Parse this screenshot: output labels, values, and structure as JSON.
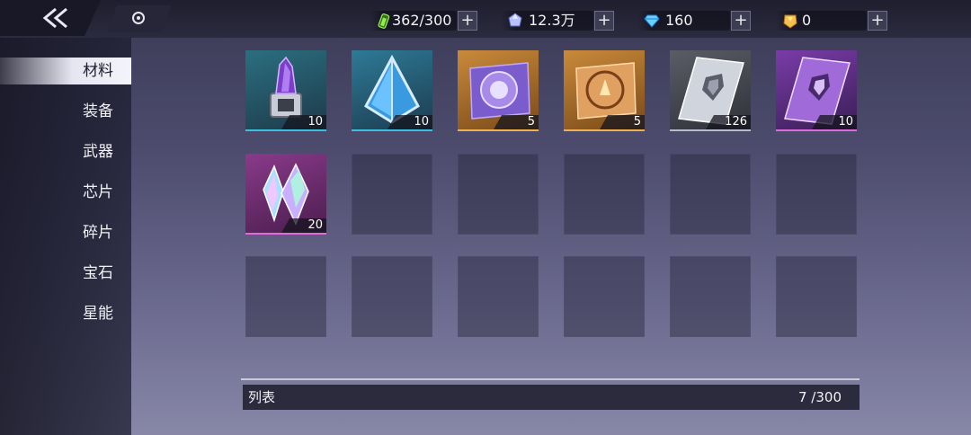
{
  "resources": [
    {
      "name": "stamina-icon",
      "value": "362/300",
      "color": "#7fd23a"
    },
    {
      "name": "crystal-icon",
      "value": "12.3万",
      "color": "#9aa9ff"
    },
    {
      "name": "diamond-icon",
      "value": "160",
      "color": "#4fb8ff"
    },
    {
      "name": "gold-gem-icon",
      "value": "0",
      "color": "#f0b030"
    }
  ],
  "sidebar": {
    "items": [
      {
        "label": "材料",
        "active": true
      },
      {
        "label": "装备"
      },
      {
        "label": "武器"
      },
      {
        "label": "芯片"
      },
      {
        "label": "碎片"
      },
      {
        "label": "宝石"
      },
      {
        "label": "星能"
      }
    ]
  },
  "inventory": {
    "items": [
      {
        "icon": "purple-crystal-reactor-icon",
        "count": "10",
        "rarity": "blue"
      },
      {
        "icon": "blue-prism-crystal-icon",
        "count": "10",
        "rarity": "blue"
      },
      {
        "icon": "purple-chip-card-icon",
        "count": "5",
        "rarity": "gold"
      },
      {
        "icon": "gold-chip-card-icon",
        "count": "5",
        "rarity": "gold"
      },
      {
        "icon": "silver-wolf-book-icon",
        "count": "126",
        "rarity": "grey"
      },
      {
        "icon": "purple-wolf-book-icon",
        "count": "10",
        "rarity": "purple"
      },
      {
        "icon": "rainbow-crystal-cluster-icon",
        "count": "20",
        "rarity": "pink"
      }
    ]
  },
  "footer": {
    "label": "列表",
    "count": "7 /300"
  }
}
